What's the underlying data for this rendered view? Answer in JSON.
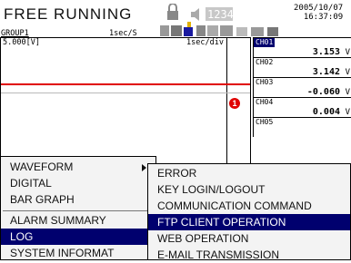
{
  "header": {
    "status": "FREE RUNNING",
    "group": "GROUP1",
    "sample_rate": "1sec/S",
    "date": "2005/10/07",
    "time": "16:37:09",
    "counter": "1234"
  },
  "graph": {
    "scale_label": "5.000[V]",
    "time_div": "1sec/div",
    "alarm_marker": "1"
  },
  "channels": [
    {
      "tag": "CH01",
      "value": "3.153",
      "unit": "V",
      "selected": true
    },
    {
      "tag": "CH02",
      "value": "3.142",
      "unit": "V",
      "selected": false
    },
    {
      "tag": "CH03",
      "value": "-0.060",
      "unit": "V",
      "selected": false
    },
    {
      "tag": "CH04",
      "value": "0.004",
      "unit": "V",
      "selected": false
    },
    {
      "tag": "CH05",
      "value": "",
      "unit": "",
      "selected": false
    }
  ],
  "main_menu": {
    "items": [
      {
        "label": "WAVEFORM",
        "has_submenu": true
      },
      {
        "label": "DIGITAL"
      },
      {
        "label": "BAR GRAPH"
      },
      {
        "label": "ALARM SUMMARY"
      },
      {
        "label": "LOG",
        "selected": true
      },
      {
        "label": "SYSTEM INFORMAT"
      }
    ]
  },
  "sub_menu": {
    "items": [
      {
        "label": "ERROR"
      },
      {
        "label": "KEY LOGIN/LOGOUT"
      },
      {
        "label": "COMMUNICATION COMMAND"
      },
      {
        "label": "FTP CLIENT OPERATION",
        "selected": true
      },
      {
        "label": "WEB OPERATION"
      },
      {
        "label": "E-MAIL TRANSMISSION"
      }
    ]
  },
  "colors": {
    "selection": "#00006e",
    "trace_red": "#e00000",
    "menu_bg": "#f3f3f3"
  },
  "icons": [
    "lock-icon",
    "speaker-icon",
    "counter-icon",
    "status-icons"
  ]
}
